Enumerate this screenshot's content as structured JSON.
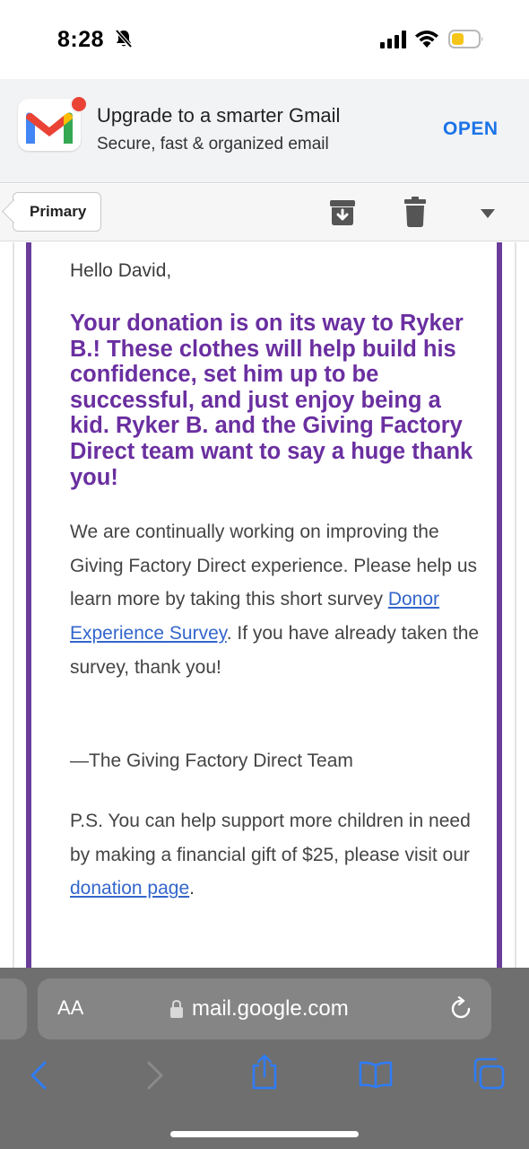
{
  "status_bar": {
    "time": "8:28",
    "icons": [
      "bell-slash-icon",
      "signal-icon",
      "wifi-icon",
      "battery-icon"
    ],
    "battery_color": "#f5c518"
  },
  "banner": {
    "title": "Upgrade to a smarter Gmail",
    "subtitle": "Secure, fast & organized email",
    "open_label": "OPEN",
    "accent": "#1a73e8"
  },
  "toolbar": {
    "primary_label": "Primary",
    "icons": [
      "archive-icon",
      "trash-icon",
      "chevron-down-icon"
    ]
  },
  "email": {
    "greeting": "Hello David,",
    "headline": "Your donation is on its way to Ryker B.! These clothes will help build his confidence, set him up to be successful, and just enjoy being a kid. Ryker B. and the Giving Factory Direct team want to say a huge thank you!",
    "para1_pre": "We are continually working on improving the Giving Factory Direct experience. Please help us learn more by taking this short survey ",
    "para1_link": "Donor Experience Survey",
    "para1_post": ". If you have already taken the survey, thank you!",
    "signoff": "—The Giving Factory Direct Team",
    "ps_pre": "P.S. You can help support more children in need by making a financial gift of $25, please visit our ",
    "ps_link": "donation page",
    "ps_post": ".",
    "accent": "#6a2fa0",
    "link_color": "#3366cc"
  },
  "safari": {
    "aa_label": "AA",
    "url": "mail.google.com",
    "icons": [
      "lock-icon",
      "reload-icon",
      "back-icon",
      "forward-icon",
      "share-icon",
      "bookmarks-icon",
      "tabs-icon"
    ],
    "tint": "#2f7cf6"
  }
}
